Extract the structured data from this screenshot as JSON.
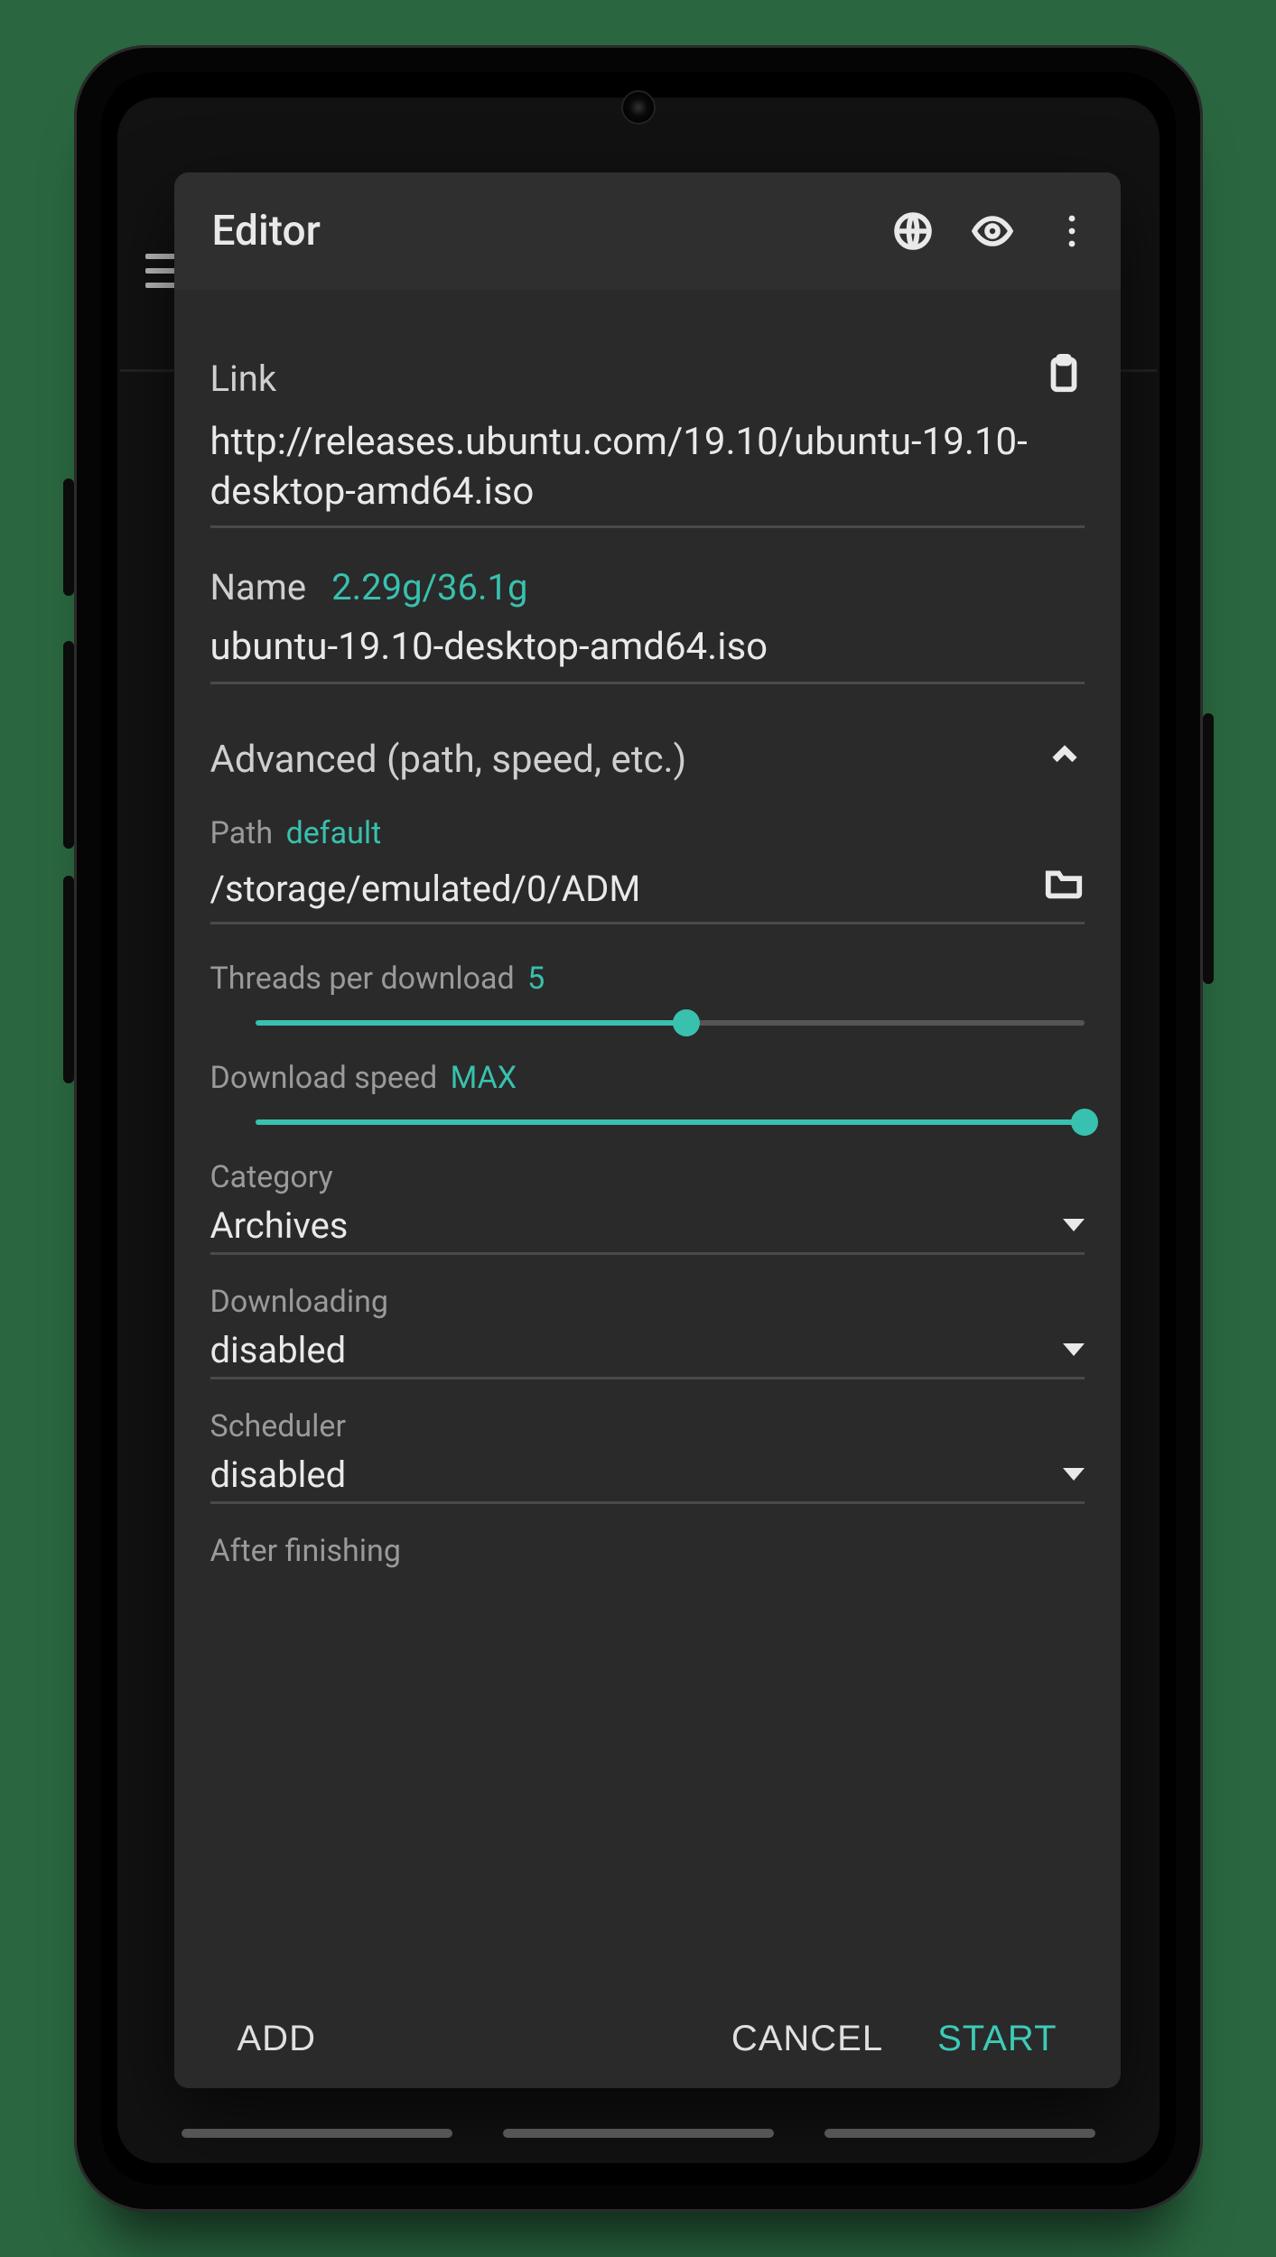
{
  "dialog": {
    "title": "Editor",
    "link_label": "Link",
    "link_value": "http://releases.ubuntu.com/19.10/ubuntu-19.10-desktop-amd64.iso",
    "name_label": "Name",
    "name_size": "2.29g/36.1g",
    "name_value": "ubuntu-19.10-desktop-amd64.iso",
    "advanced_label": "Advanced (path, speed, etc.)",
    "path_label": "Path",
    "path_hint": "default",
    "path_value": "/storage/emulated/0/ADM",
    "threads_label": "Threads per download",
    "threads_value": "5",
    "threads_percent": 52,
    "speed_label": "Download speed",
    "speed_value": "MAX",
    "speed_percent": 100,
    "category_label": "Category",
    "category_value": "Archives",
    "downloading_label": "Downloading",
    "downloading_value": "disabled",
    "scheduler_label": "Scheduler",
    "scheduler_value": "disabled",
    "after_label": "After finishing",
    "actions": {
      "add": "ADD",
      "cancel": "CANCEL",
      "start": "START"
    }
  },
  "accent_color": "#38c1ae"
}
